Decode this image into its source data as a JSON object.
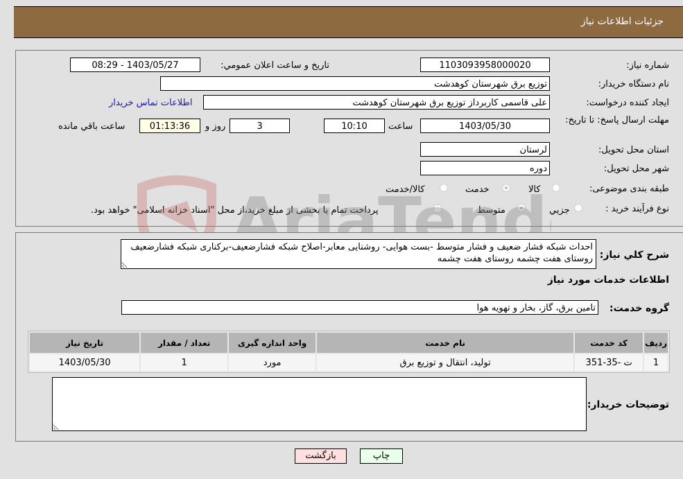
{
  "header": {
    "title": "جزئیات اطلاعات نیاز"
  },
  "form": {
    "need_number_label": "شماره نیاز:",
    "need_number": "1103093958000020",
    "announce_label": "تاريخ و ساعت اعلان عمومي:",
    "announce_value": "1403/05/27 - 08:29",
    "buyer_org_label": "نام دستگاه خريدار:",
    "buyer_org": "توزیع برق شهرستان کوهدشت",
    "requester_label": "ایجاد کننده درخواست:",
    "requester": "علی قاسمی کاربرداز توزیع برق شهرستان کوهدشت",
    "buyer_contact_link": "اطلاعات تماس خريدار",
    "deadline_label": "مهلت ارسال پاسخ: تا تاریخ:",
    "deadline_date": "1403/05/30",
    "time_label": "ساعت",
    "deadline_time": "10:10",
    "days": "3",
    "days_label": "روز و",
    "remaining": "01:13:36",
    "remaining_label": "ساعت باقي مانده",
    "province_label": "استان محل تحویل:",
    "province": "لرستان",
    "city_label": "شهر محل تحویل:",
    "city": "دوره",
    "category_label": "طبقه بندی موضوعی:",
    "category_options": [
      {
        "label": "کالا",
        "selected": false
      },
      {
        "label": "خدمت",
        "selected": true
      },
      {
        "label": "کالا/خدمت",
        "selected": false
      }
    ],
    "process_label": "نوع فرآیند خرید :",
    "process_options": [
      {
        "label": "جزيي",
        "selected": false
      },
      {
        "label": "متوسط",
        "selected": true
      }
    ],
    "treasury_note": "پرداخت تمام یا بخشی از مبلغ خرید،از محل \"اسناد خزانه اسلامی\" خواهد بود.",
    "treasury_checked": false
  },
  "details": {
    "description_label": "شرح کلي نياز:",
    "description": "احداث شبکه فشار ضعیف و فشار متوسط -بست هوایی- روشنایی معابر-اصلاح شبکه فشارضعیف-برکناری شبکه فشارضعیف روستای هفت چشمه روستای هفت چشمه",
    "services_heading": "اطلاعات خدمات مورد نياز",
    "service_group_label": "گروه خدمت:",
    "service_group": "تامین برق، گاز، بخار و تهویه هوا",
    "table": {
      "headers": [
        "رديف",
        "کد خدمت",
        "نام خدمت",
        "واحد اندازه گيری",
        "تعداد / مقدار",
        "تاريخ نياز"
      ],
      "rows": [
        [
          "1",
          "ت -35-351",
          "تولید، انتقال و توزیع برق",
          "مورد",
          "1",
          "1403/05/30"
        ]
      ]
    },
    "buyer_notes_label": "توضيحات خريدار:",
    "buyer_notes": ""
  },
  "buttons": {
    "print": "چاپ",
    "back": "بازگشت"
  },
  "watermark": {
    "text": "AriaTender.neT"
  }
}
